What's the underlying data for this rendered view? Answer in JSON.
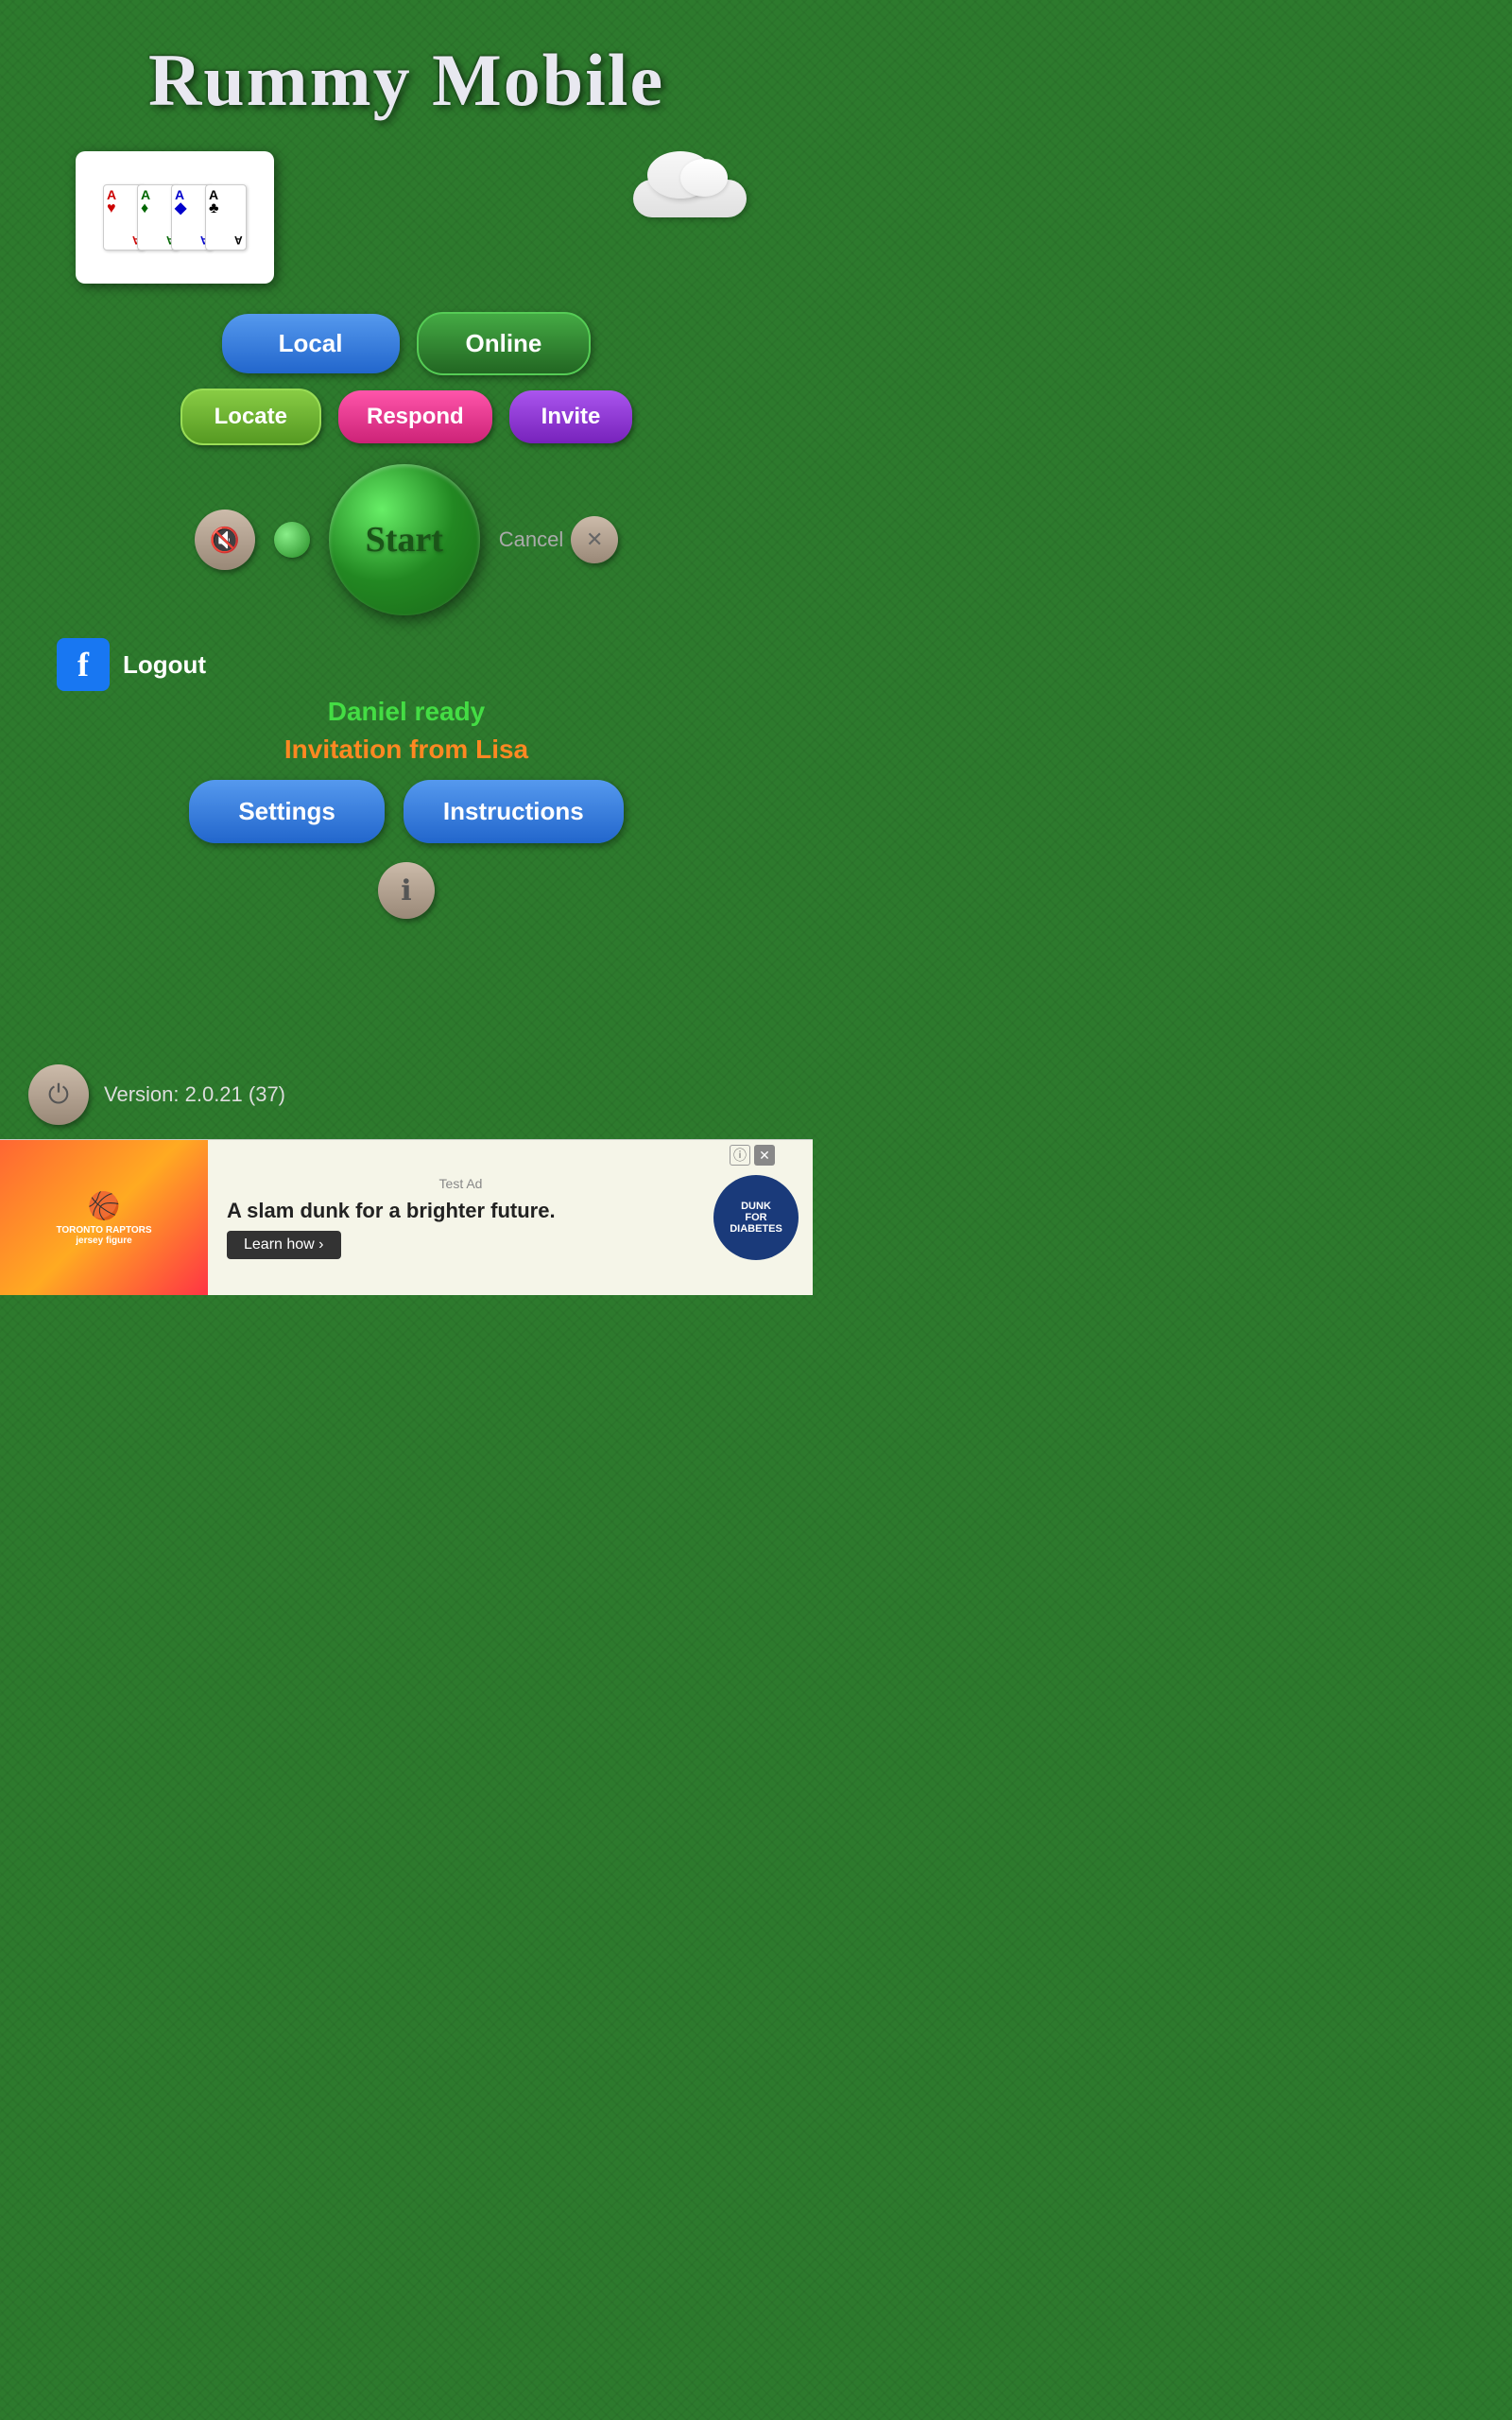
{
  "app": {
    "title": "Rummy Mobile"
  },
  "buttons": {
    "local": "Local",
    "online": "Online",
    "locate": "Locate",
    "respond": "Respond",
    "invite": "Invite",
    "start": "Start",
    "cancel": "Cancel",
    "logout": "Logout",
    "settings": "Settings",
    "instructions": "Instructions"
  },
  "status": {
    "player_ready": "Daniel ready",
    "invitation": "Invitation from Lisa"
  },
  "version": {
    "text": "Version: 2.0.21 (37)"
  },
  "ad": {
    "label": "Test Ad",
    "text": "A slam dunk for a brighter future.",
    "learn_more": "Learn how ›",
    "badge_line1": "DUNK",
    "badge_line2": "FOR",
    "badge_line3": "DIABETES"
  },
  "cards": [
    {
      "rank": "A",
      "suit": "♥",
      "color": "card-red"
    },
    {
      "rank": "A",
      "suit": "♦",
      "color": "card-green"
    },
    {
      "rank": "A",
      "suit": "♦",
      "color": "card-blue"
    },
    {
      "rank": "A",
      "suit": "♣",
      "color": "card-black"
    }
  ]
}
